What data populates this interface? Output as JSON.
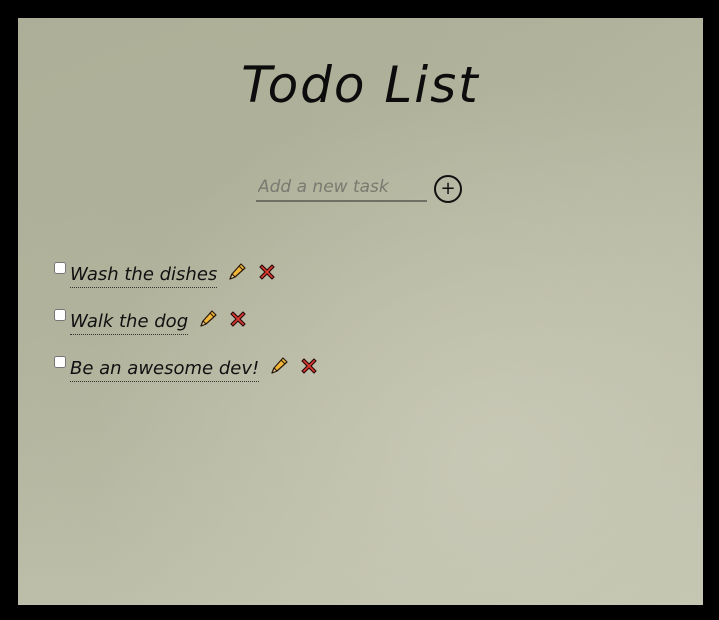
{
  "app": {
    "title": "Todo List"
  },
  "new_task": {
    "placeholder": "Add a new task",
    "value": "",
    "add_button_label": "+"
  },
  "todos": [
    {
      "text": "Wash the dishes",
      "checked": false
    },
    {
      "text": "Walk the dog",
      "checked": false
    },
    {
      "text": "Be an awesome dev!",
      "checked": false
    }
  ],
  "icons": {
    "edit": "pencil-icon",
    "delete": "cross-icon"
  },
  "colors": {
    "page_frame": "#000000",
    "background": "#b6b8a2",
    "text": "#111111",
    "pencil": "#f2b739",
    "delete": "#d9392f"
  }
}
